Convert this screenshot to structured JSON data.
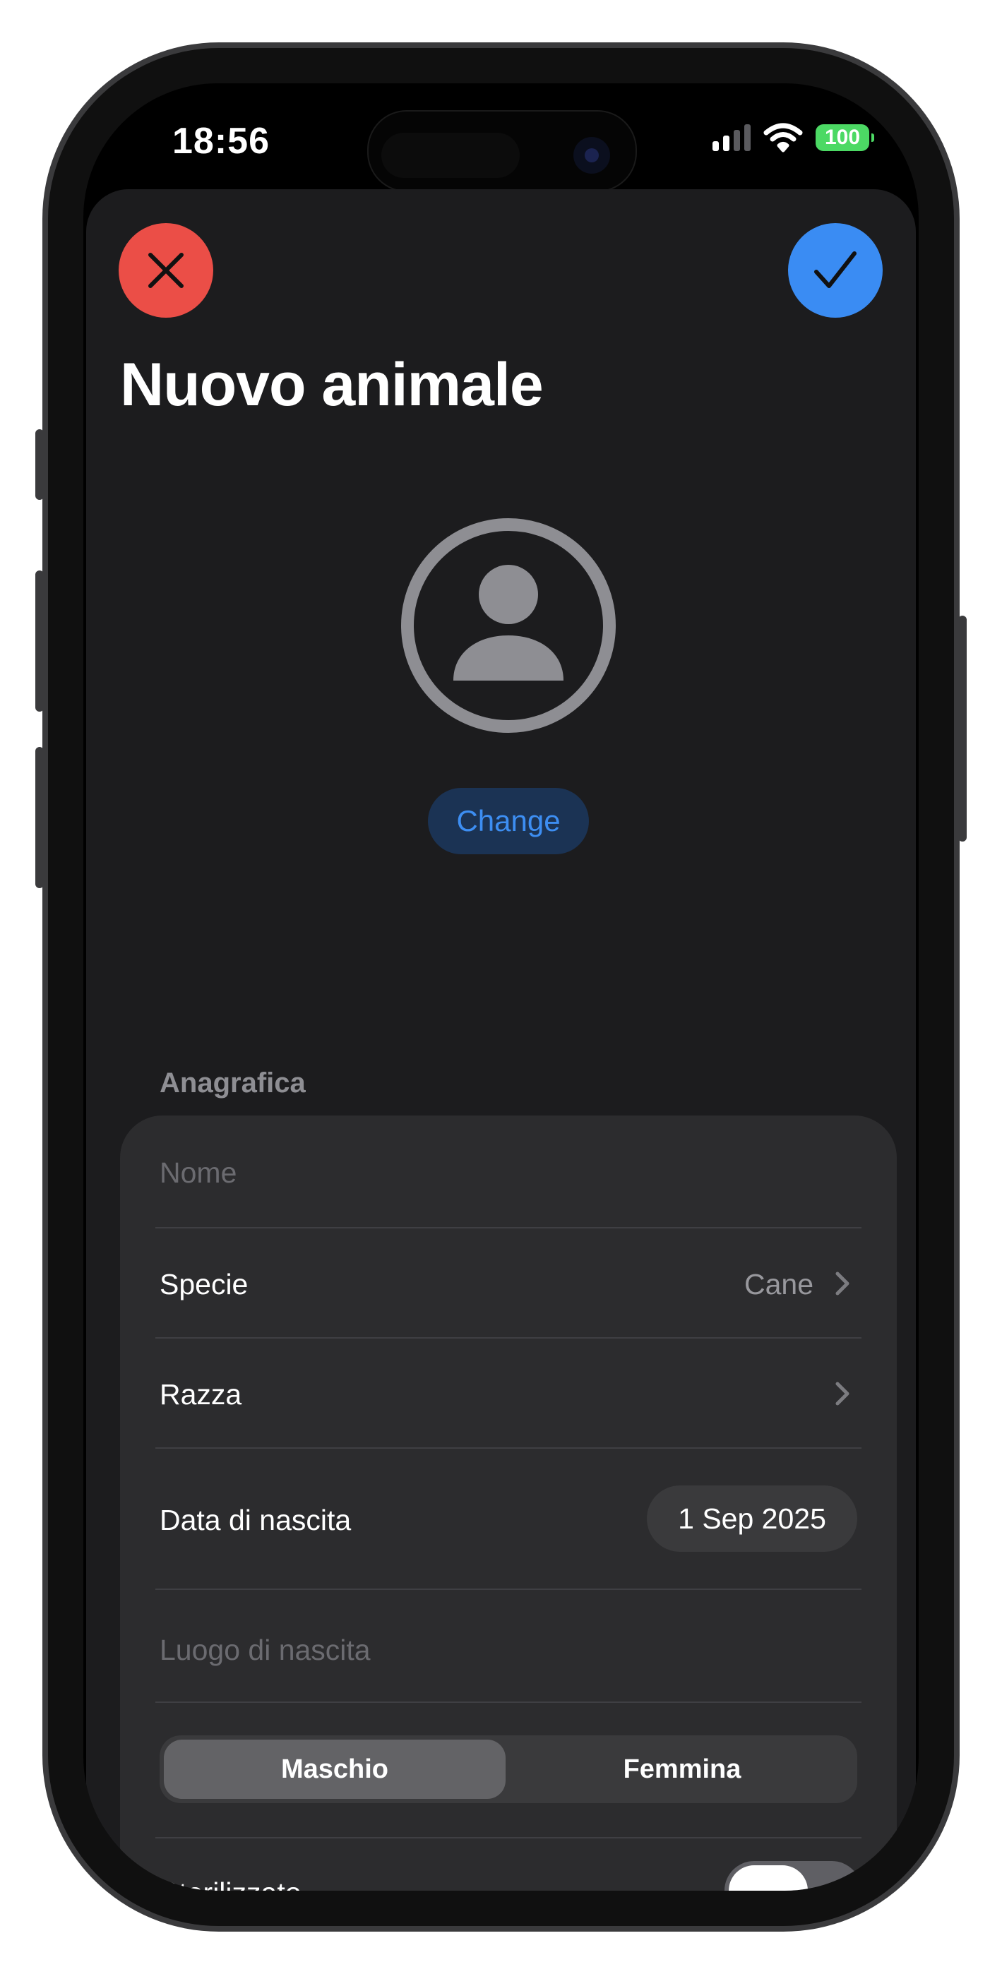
{
  "status_bar": {
    "time": "18:56",
    "battery": "100"
  },
  "header": {
    "title": "Nuovo animale",
    "close_icon": "xmark-icon",
    "confirm_icon": "checkmark-icon"
  },
  "avatar": {
    "icon": "person-circle-icon",
    "change_label": "Change"
  },
  "form": {
    "section_title": "Anagrafica",
    "name": {
      "placeholder": "Nome",
      "value": ""
    },
    "species": {
      "label": "Specie",
      "value": "Cane"
    },
    "breed": {
      "label": "Razza",
      "value": ""
    },
    "birth_date": {
      "label": "Data di nascita",
      "value": "1 Sep 2025"
    },
    "birth_place": {
      "placeholder": "Luogo di nascita",
      "value": ""
    },
    "sex": {
      "options": [
        "Maschio",
        "Femmina"
      ],
      "selected": "Maschio"
    },
    "sterilized": {
      "label": "Sterilizzato",
      "value": false
    }
  },
  "colors": {
    "close_button": "#eb4e47",
    "confirm_button": "#3a8cf3",
    "accent": "#3d8ef2",
    "battery": "#4cd964",
    "sheet_background": "#1c1c1e",
    "card_background": "#2c2c2e"
  }
}
